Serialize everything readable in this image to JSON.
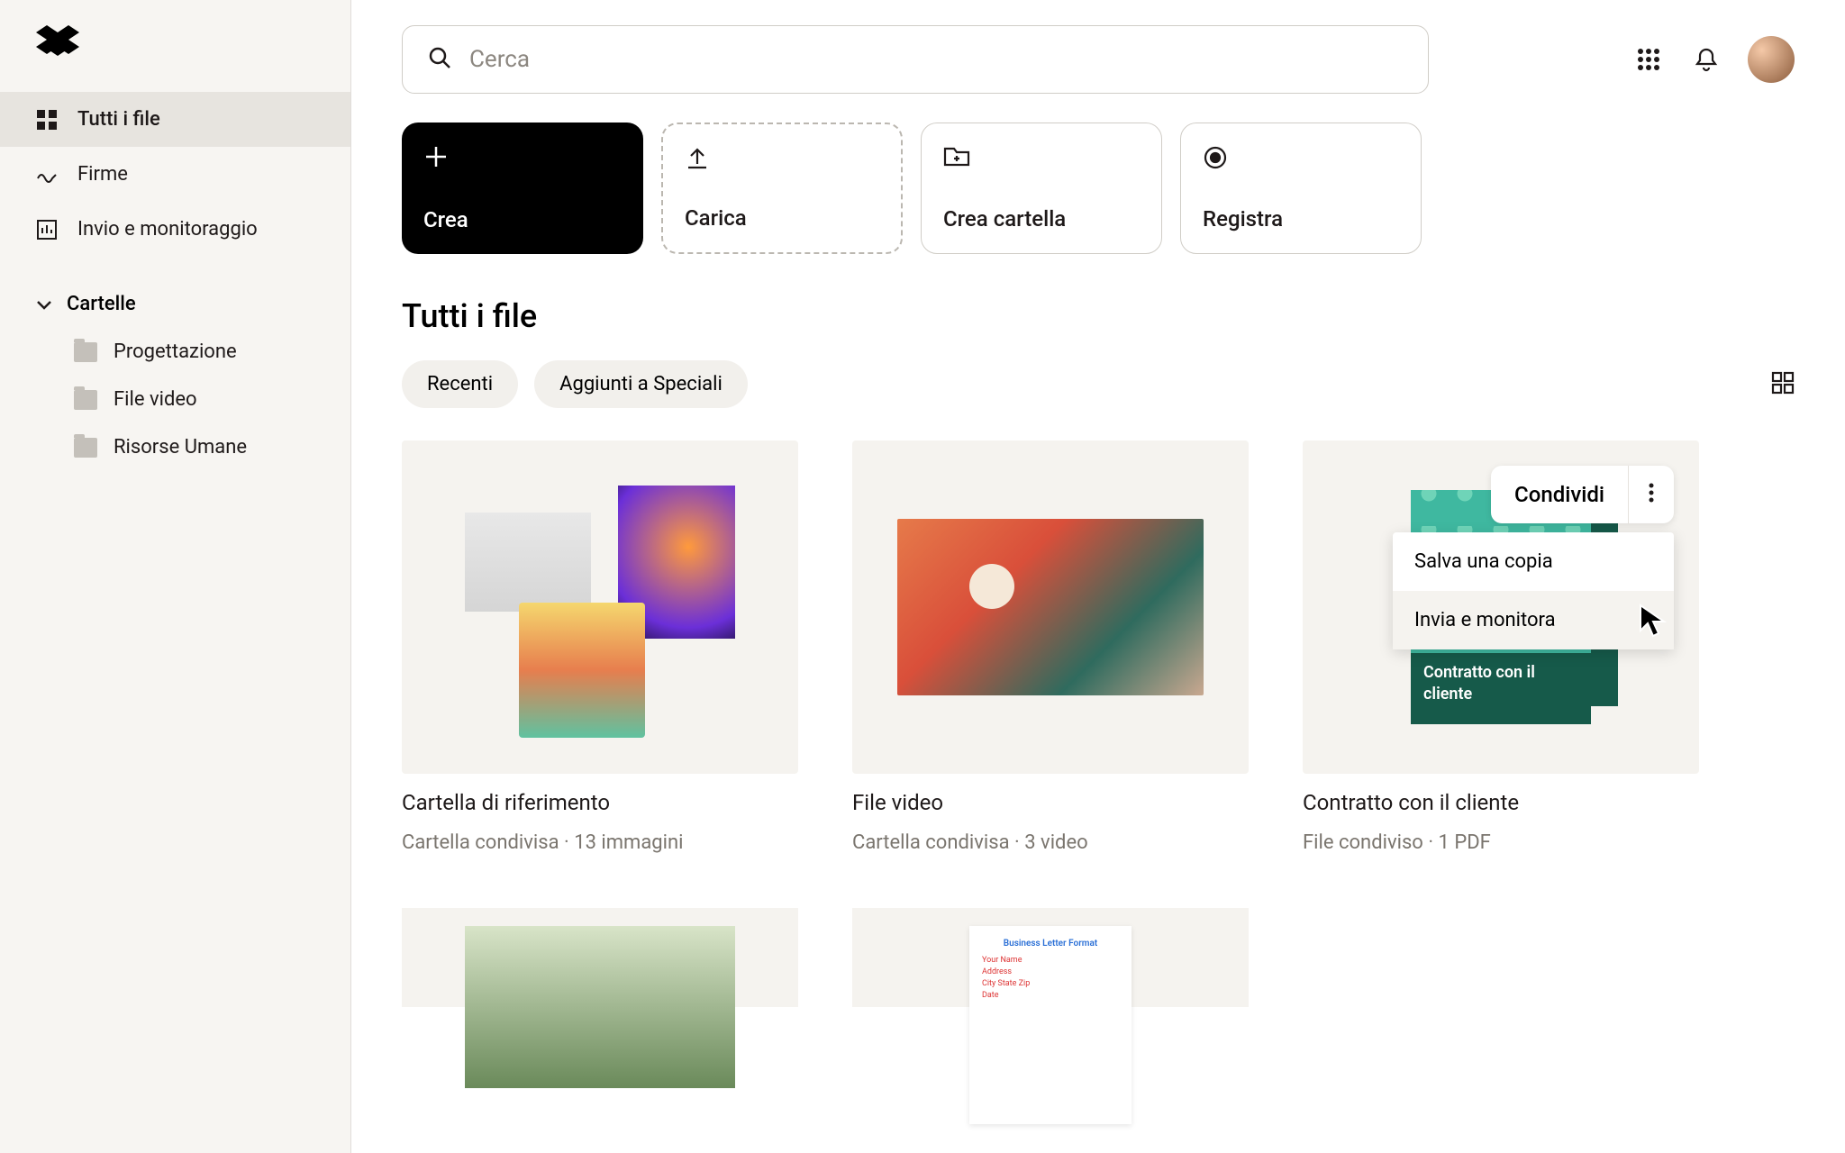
{
  "search": {
    "placeholder": "Cerca"
  },
  "sidebar": {
    "nav": [
      {
        "label": "Tutti i file"
      },
      {
        "label": "Firme"
      },
      {
        "label": "Invio e monitoraggio"
      }
    ],
    "folders_header": "Cartelle",
    "folders": [
      {
        "label": "Progettazione"
      },
      {
        "label": "File video"
      },
      {
        "label": "Risorse Umane"
      }
    ]
  },
  "actions": {
    "create": "Crea",
    "upload": "Carica",
    "new_folder": "Crea cartella",
    "record": "Registra"
  },
  "page_title": "Tutti i file",
  "filters": {
    "recent": "Recenti",
    "starred": "Aggiunti a Speciali"
  },
  "cards": [
    {
      "title": "Cartella di riferimento",
      "subtitle": "Cartella condivisa · 13 immagini"
    },
    {
      "title": "File video",
      "subtitle": "Cartella condivisa · 3 video"
    },
    {
      "title": "Contratto con il cliente",
      "subtitle": "File condiviso · 1 PDF",
      "doc_label": "Contratto con il cliente"
    }
  ],
  "share": {
    "button": "Condividi",
    "menu": [
      "Salva una copia",
      "Invia e monitora"
    ]
  }
}
